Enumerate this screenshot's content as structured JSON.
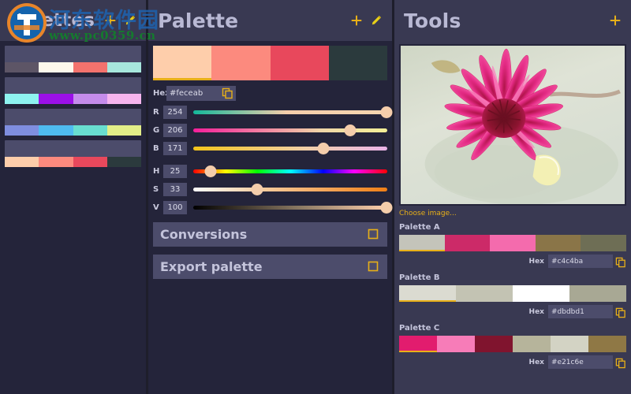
{
  "palettes_panel": {
    "title": "Palettes",
    "actions": [
      {
        "name": "add-palette-icon",
        "glyph": "plus",
        "color": "#e8b018"
      },
      {
        "name": "edit-palette-icon",
        "glyph": "pencil",
        "color": "#e8d018"
      }
    ],
    "items": [
      {
        "name": "palette-1",
        "active": false,
        "colors": [
          "#5d5566",
          "#fdf8ec",
          "#f3726d",
          "#a7e7dd"
        ]
      },
      {
        "name": "palette-2",
        "active": false,
        "colors": [
          "#8ef3f0",
          "#9b10e8",
          "#c58ceb",
          "#f6b5ee"
        ]
      },
      {
        "name": "palette-3",
        "active": false,
        "colors": [
          "#7f8ee0",
          "#4fbbf0",
          "#69ded0",
          "#e3ee88"
        ]
      },
      {
        "name": "palette-4",
        "active": true,
        "colors": [
          "#feceab",
          "#fc8a7e",
          "#e8485c",
          "#2b3a3d"
        ]
      }
    ]
  },
  "palette_panel": {
    "title": "Palette",
    "actions": [
      {
        "name": "add-color-icon",
        "glyph": "plus",
        "color": "#e8b018"
      },
      {
        "name": "edit-color-icon",
        "glyph": "pencil",
        "color": "#e8d018"
      }
    ],
    "swatch": {
      "colors": [
        "#feceab",
        "#fc8a7e",
        "#e8485c",
        "#2b3a3d"
      ],
      "selected_index": 0
    },
    "hex": {
      "label": "Hex",
      "value": "#feceab",
      "placeholder": "#000000",
      "copy_icon": "copy-icon"
    },
    "channels": [
      {
        "label": "R",
        "value": "254",
        "knob_pct": 99.6,
        "gradient": "linear-gradient(90deg,#14b89a 0%,#f4cdab 48%,#f5d6b0 100%)"
      },
      {
        "label": "G",
        "value": "206",
        "knob_pct": 80.8,
        "gradient": "linear-gradient(90deg,#f41f9a 0%,#efd6a8 66%,#f3ef96 100%)"
      },
      {
        "label": "B",
        "value": "171",
        "knob_pct": 67.1,
        "gradient": "linear-gradient(90deg,#f3c41a 0%,#f0cfa7 58%,#e9b3e8 100%)"
      }
    ],
    "hsv": [
      {
        "label": "H",
        "value": "25",
        "knob_pct": 9.0,
        "gradient": "linear-gradient(90deg,#ff0000 0%,#ffff00 17%,#00ff00 33%,#00ffff 50%,#0000ff 67%,#ff00ff 83%,#ff0000 100%)"
      },
      {
        "label": "S",
        "value": "33",
        "knob_pct": 33.0,
        "gradient": "linear-gradient(90deg,#fdfcfa 0%,#f6cfa4 33%,#f07f16 100%)"
      },
      {
        "label": "V",
        "value": "100",
        "knob_pct": 99.5,
        "gradient": "linear-gradient(90deg,#000000 0%,#8b7963 55%,#feceab 100%)"
      }
    ],
    "buttons": [
      {
        "name": "conversions-button",
        "label": "Conversions",
        "icon": "expand-icon"
      },
      {
        "name": "export-palette-button",
        "label": "Export palette",
        "icon": "expand-icon"
      }
    ]
  },
  "tools_panel": {
    "title": "Tools",
    "actions": [
      {
        "name": "add-tool-icon",
        "glyph": "plus",
        "color": "#e8b018"
      }
    ],
    "image": {
      "name": "source-image",
      "alt": "pink water lily flower",
      "choose_label": "Choose image..."
    },
    "extracted": [
      {
        "name": "Palette A",
        "colors": [
          "#c4c4ba",
          "#cc2a68",
          "#f46bad",
          "#8a7548",
          "#6e6e55"
        ],
        "selected_index": 0,
        "hex_label": "Hex",
        "hex_value": "#c4c4ba"
      },
      {
        "name": "Palette B",
        "colors": [
          "#dbdbd1",
          "#c3c3b3",
          "#ffffff",
          "#a8a894"
        ],
        "selected_index": 0,
        "hex_label": "Hex",
        "hex_value": "#dbdbd1"
      },
      {
        "name": "Palette C",
        "colors": [
          "#e21c6e",
          "#f77cb8",
          "#80142e",
          "#b6b49b",
          "#d3d3c4",
          "#8f7845"
        ],
        "selected_index": 0,
        "hex_label": "Hex",
        "hex_value": "#e21c6e"
      }
    ]
  },
  "watermark": {
    "chinese": "河东软件园",
    "url": "www.pc0359.cn"
  },
  "theme": {
    "bg": "#1e1e2b",
    "panel_dark": "#24243a",
    "panel_light": "#393952",
    "control": "#4c4c6b",
    "text": "#c4c4db",
    "accent": "#e8b018"
  }
}
